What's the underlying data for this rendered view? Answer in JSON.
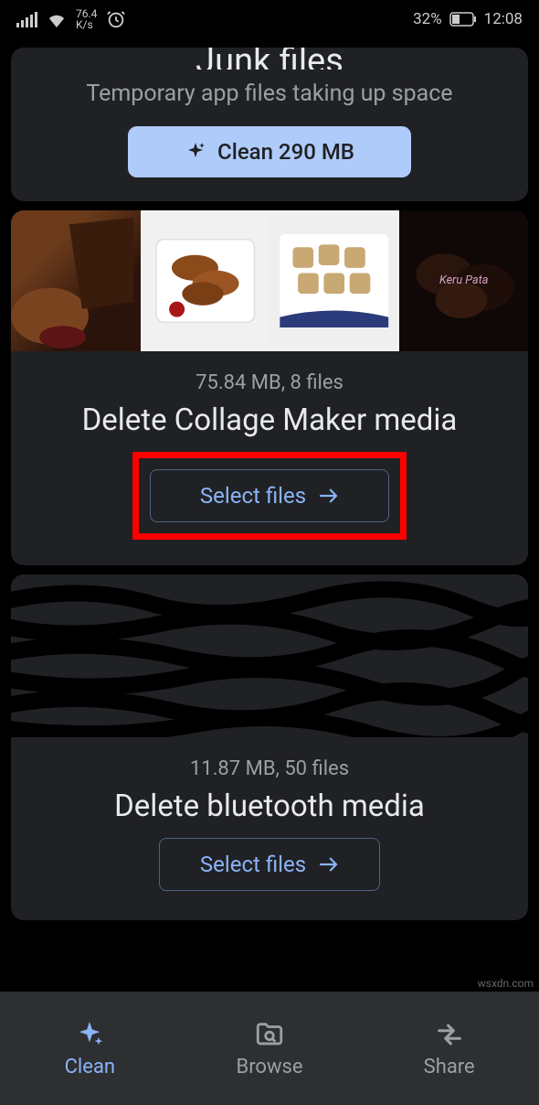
{
  "status": {
    "net_speed_top": "76.4",
    "net_speed_bot": "K/s",
    "battery_pct": "32%",
    "time": "12:08"
  },
  "junk_card": {
    "title_cut": "Junk files",
    "subtitle": "Temporary app files taking up space",
    "clean_button": "Clean 290 MB"
  },
  "collage_card": {
    "meta": "75.84 MB, 8 files",
    "title": "Delete Collage Maker media",
    "button": "Select files"
  },
  "bluetooth_card": {
    "meta": "11.87 MB, 50 files",
    "title": "Delete bluetooth media",
    "button": "Select files"
  },
  "bottom_nav": {
    "clean": "Clean",
    "browse": "Browse",
    "share": "Share"
  },
  "watermark": "wsxdn.com"
}
